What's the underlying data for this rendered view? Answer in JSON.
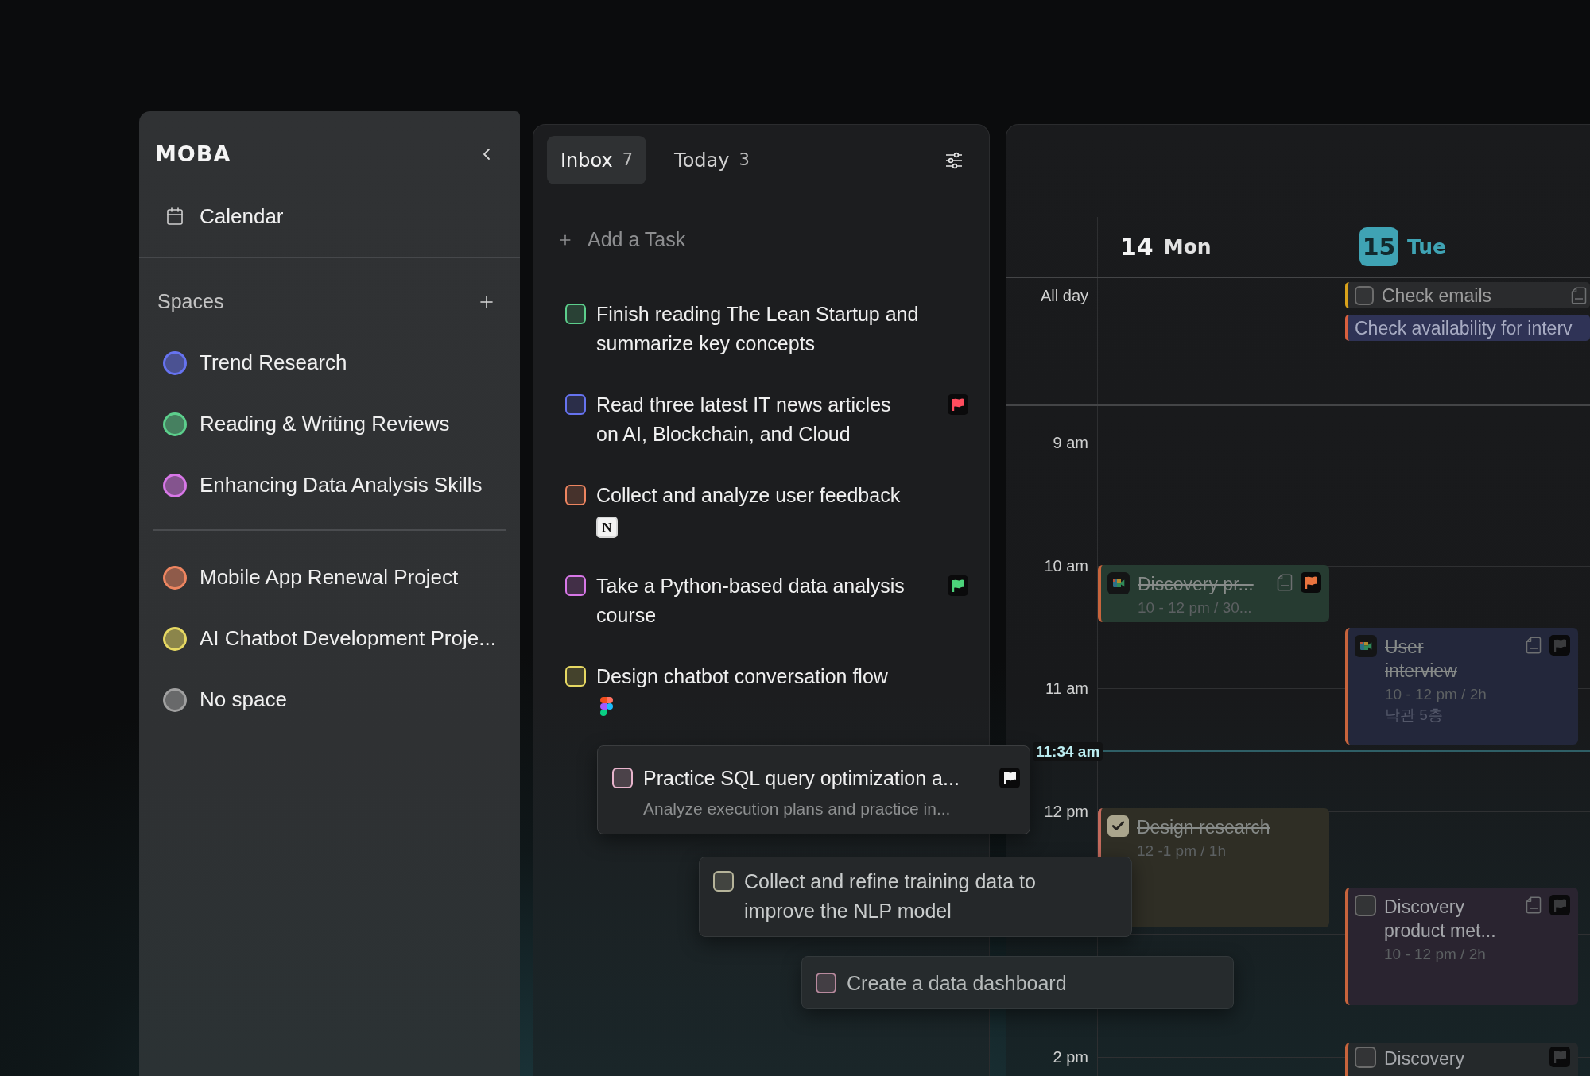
{
  "sidebar": {
    "logo": "MOBA",
    "nav": [
      {
        "label": "Calendar"
      }
    ],
    "spaces_title": "Spaces",
    "space_groups": [
      {
        "items": [
          {
            "name": "Trend Research",
            "color": "#6673f0"
          },
          {
            "name": "Reading & Writing Reviews",
            "color": "#5ccf8c"
          },
          {
            "name": "Enhancing Data Analysis Skills",
            "color": "#d877e8"
          }
        ]
      },
      {
        "items": [
          {
            "name": "Mobile App Renewal Project",
            "color": "#ee8560"
          },
          {
            "name": "AI Chatbot Development Proje...",
            "color": "#e6d862"
          },
          {
            "name": "No space",
            "color": "#a0a0a0"
          }
        ]
      }
    ]
  },
  "tasks_panel": {
    "tabs": [
      {
        "label": "Inbox",
        "count": "7",
        "selected": true
      },
      {
        "label": "Today",
        "count": "3",
        "selected": false
      }
    ],
    "add_task": "Add a Task",
    "tasks": [
      {
        "title": "Finish reading The Lean Startup and summarize key concepts",
        "color": "#5ccf8c",
        "checked": false
      },
      {
        "title": "Read three latest IT news articles on AI, Blockchain, and Cloud",
        "color": "#6673f0",
        "checked": false,
        "flag": {
          "color": "#ff4d5e"
        }
      },
      {
        "title": "Collect and analyze user feedback",
        "color": "#ee8560",
        "checked": false,
        "attachment": {
          "kind": "tile",
          "label": "N"
        }
      },
      {
        "title": "Take a Python-based data analysis course",
        "color": "#d877e8",
        "checked": false,
        "flag": {
          "color": "#4cd27a"
        }
      },
      {
        "title": "Design chatbot conversation flow",
        "color": "#e6d862",
        "checked": false,
        "attachment": {
          "kind": "shapes"
        }
      }
    ]
  },
  "floating_tasks": [
    {
      "title": "Practice SQL query optimization a...",
      "note": "Analyze execution plans and practice in...",
      "color": "#e8b4cc",
      "checked": false,
      "flag": {
        "color": "#f4f4f4"
      }
    },
    {
      "title": "Collect and refine training data to improve the NLP model",
      "color": "#b6b49a",
      "checked": false
    },
    {
      "title": "Create a data dashboard",
      "color": "#b88a9e",
      "checked": false
    }
  ],
  "calendar": {
    "all_day_label": "All day",
    "hours": [
      "9 am",
      "10 am",
      "11 am",
      "12 pm",
      "2 pm"
    ],
    "now": "11:34 am",
    "days": [
      {
        "date": "14",
        "weekday": "Mon",
        "selected": false,
        "events": [
          {
            "kind": "meeting",
            "title": "Discovery pr...",
            "time": "10 - 12 pm / 30...",
            "done": true,
            "color": "#263b31",
            "bar": {
              "color": "#c8643c"
            },
            "doc": true,
            "flag": {
              "color": "#e8733e"
            }
          },
          {
            "kind": "task",
            "title": "Design research",
            "time": "12 -1 pm / 1h",
            "done": true,
            "checked": true,
            "color": "#2f2e25",
            "bar": {
              "color": "#c46a5c"
            }
          }
        ]
      },
      {
        "date": "15",
        "weekday": "Tue",
        "selected": true,
        "all_day": [
          {
            "kind": "task",
            "title": "Check emails",
            "checked": false,
            "color": "#2a2b2d",
            "bar": {
              "color": "#d9a21b"
            },
            "doc": true
          },
          {
            "kind": "event",
            "title": "Check availability for interv",
            "color": "#2f3356",
            "bar": {
              "color": "#d9603e"
            }
          }
        ],
        "events": [
          {
            "kind": "meeting",
            "title": "User interview",
            "time": "10 - 12 pm / 2h",
            "place": "낙관 5층",
            "done": true,
            "color": "#23273b",
            "bar": {
              "color": "#c8643c"
            },
            "doc": true,
            "flag": {
              "color": "#3a3b3d"
            }
          },
          {
            "kind": "task",
            "title": "Discovery product met...",
            "time": "10 - 12 pm / 2h",
            "done": false,
            "checked": false,
            "color": "#2a2430",
            "bar": {
              "color": "#c8643c"
            },
            "doc": true,
            "flag": {
              "color": "#3a3b3d"
            }
          },
          {
            "kind": "task",
            "title": "Discovery",
            "done": false,
            "checked": false,
            "color": "#25292b",
            "bar": {
              "color": "#c8643c"
            },
            "flag": {
              "color": "#3a3b3d"
            }
          }
        ]
      }
    ]
  }
}
